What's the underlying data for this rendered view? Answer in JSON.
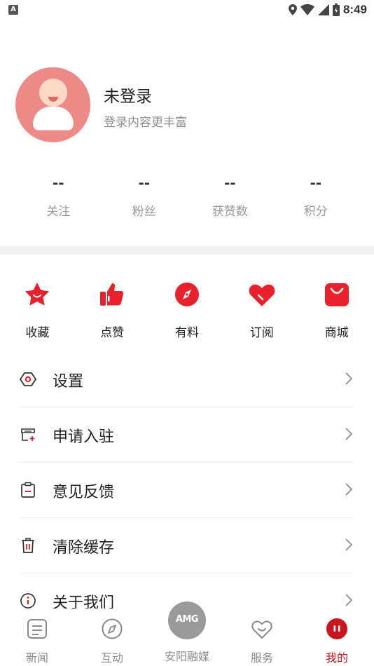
{
  "status_bar": {
    "time": "8:49",
    "left_badge": "A"
  },
  "profile": {
    "title": "未登录",
    "subtitle": "登录内容更丰富"
  },
  "stats": [
    {
      "value": "--",
      "label": "关注"
    },
    {
      "value": "--",
      "label": "粉丝"
    },
    {
      "value": "--",
      "label": "获赞数"
    },
    {
      "value": "--",
      "label": "积分"
    }
  ],
  "quick_actions": [
    {
      "label": "收藏",
      "icon": "star-icon"
    },
    {
      "label": "点赞",
      "icon": "thumbs-up-icon"
    },
    {
      "label": "有料",
      "icon": "compass-icon"
    },
    {
      "label": "订阅",
      "icon": "heart-icon"
    },
    {
      "label": "商城",
      "icon": "shopping-bag-icon"
    }
  ],
  "menu": [
    {
      "label": "设置",
      "icon": "settings-icon"
    },
    {
      "label": "申请入驻",
      "icon": "store-add-icon"
    },
    {
      "label": "意见反馈",
      "icon": "clipboard-icon"
    },
    {
      "label": "清除缓存",
      "icon": "trash-icon"
    },
    {
      "label": "关于我们",
      "icon": "info-icon"
    }
  ],
  "tabbar": {
    "tabs": [
      {
        "label": "新闻",
        "icon": "news-icon"
      },
      {
        "label": "互动",
        "icon": "compass-icon"
      },
      {
        "label": "安阳融媒",
        "icon": "amg-logo"
      },
      {
        "label": "服务",
        "icon": "heart-icon"
      },
      {
        "label": "我的",
        "icon": "profile-icon"
      }
    ],
    "logo_text": "AMG",
    "active_index": 4
  },
  "colors": {
    "accent": "#c8151e",
    "avatar_bg": "#ee8a86",
    "muted": "#999999"
  }
}
